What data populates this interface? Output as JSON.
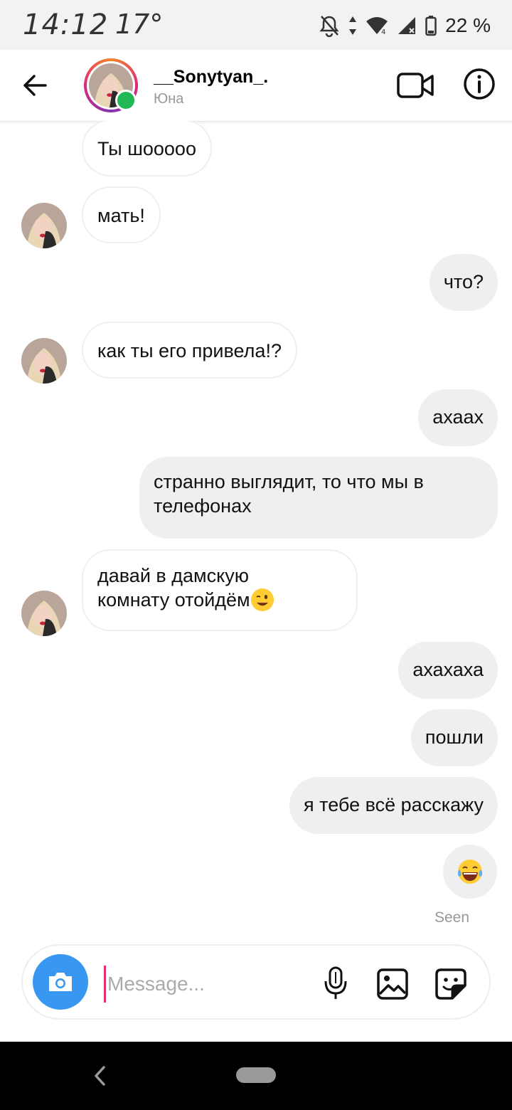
{
  "status_bar": {
    "time": "14:12",
    "temperature": "17°",
    "battery": "22 %"
  },
  "header": {
    "username": "__Sonytyan_.",
    "subtitle": "Юна",
    "online": true
  },
  "messages": [
    {
      "direction": "in",
      "text": "Ты шооооо"
    },
    {
      "direction": "in",
      "text": "мать!"
    },
    {
      "direction": "out",
      "text": "что?"
    },
    {
      "direction": "in",
      "text": "как ты его привела!?"
    },
    {
      "direction": "out",
      "text": "ахаах"
    },
    {
      "direction": "out",
      "line1": "странно выглядит, то что мы в",
      "line2": "телефонах"
    },
    {
      "direction": "in",
      "line1": "давай в дамскую",
      "line2": "комнату отойдём",
      "emoji": "winking-face"
    },
    {
      "direction": "out",
      "text": "ахахаха"
    },
    {
      "direction": "out",
      "text": "пошли"
    },
    {
      "direction": "out",
      "text": "я тебе всё расскажу"
    },
    {
      "direction": "out",
      "emoji": "laughing-tears-face"
    }
  ],
  "seen_label": "Seen",
  "composer": {
    "placeholder": "Message..."
  },
  "colors": {
    "accent_blue": "#3897f0",
    "online_green": "#1fb855",
    "incoming_bubble": "#ffffff",
    "outgoing_bubble": "#efefef"
  }
}
